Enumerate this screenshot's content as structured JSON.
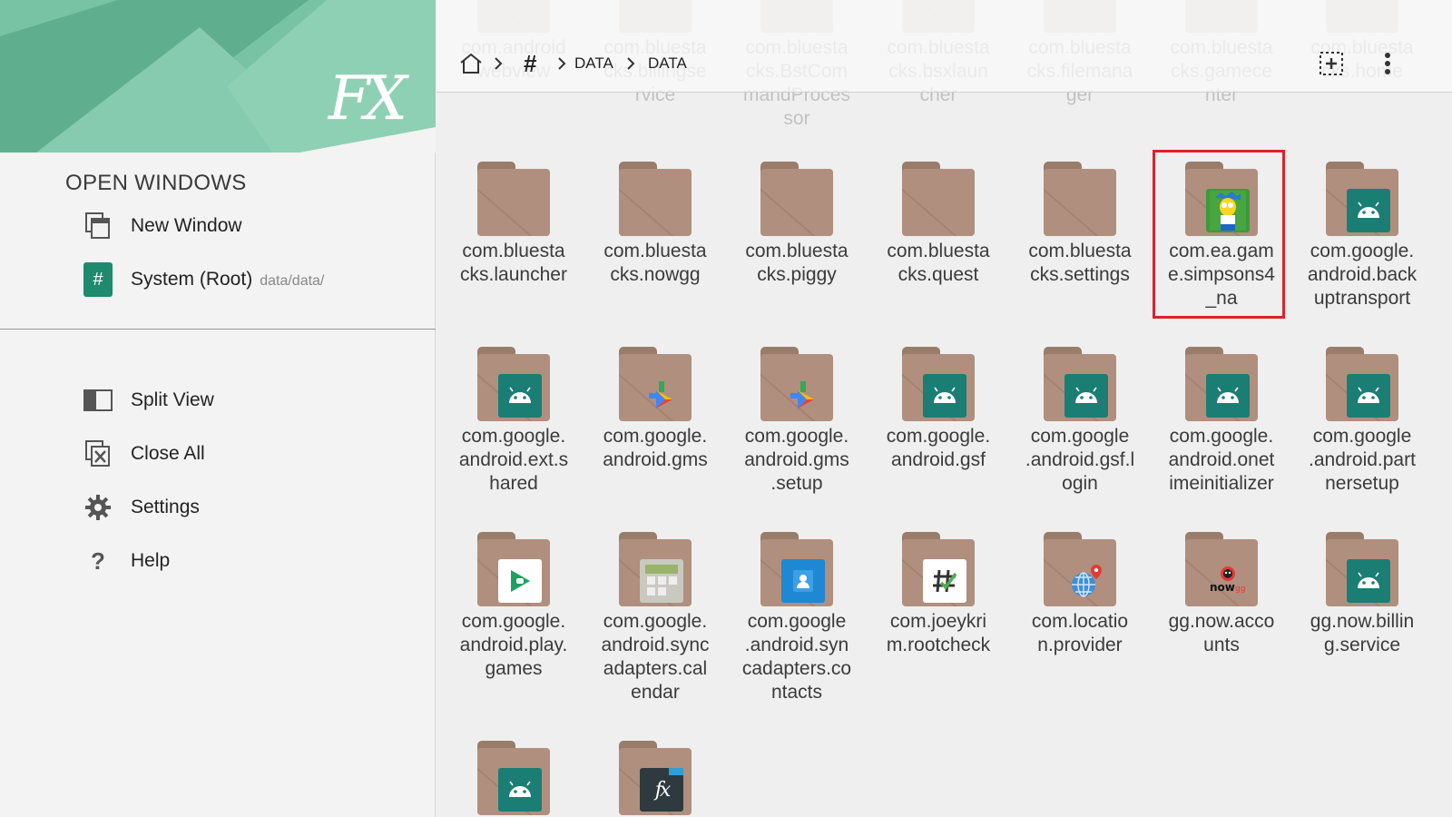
{
  "sidebar": {
    "logo_text": "FX",
    "section_title": "OPEN WINDOWS",
    "new_window": "New Window",
    "root_window": {
      "label": "System (Root)",
      "path": "data/data/",
      "badge": "#"
    },
    "split_view": "Split View",
    "close_all": "Close All",
    "settings": "Settings",
    "help": "Help"
  },
  "toolbar": {
    "crumb_root": "#",
    "crumb_1": "DATA",
    "crumb_2": "DATA"
  },
  "top_row_faded": [
    {
      "name": "com.android\nwebview"
    },
    {
      "name": "com.bluesta\ncks.billingse\nrvice"
    },
    {
      "name": "com.bluesta\ncks.BstCom\nmandProces\nsor"
    },
    {
      "name": "com.bluesta\ncks.bsxlaun\ncher"
    },
    {
      "name": "com.bluesta\ncks.filemana\nger"
    },
    {
      "name": "com.bluesta\ncks.gamece\nnter"
    },
    {
      "name": "com.bluesta\ncks.home"
    }
  ],
  "items": [
    {
      "name": "com.bluesta\ncks.launcher",
      "icon": "plain-folder-icon"
    },
    {
      "name": "com.bluesta\ncks.nowgg",
      "icon": "plain-folder-icon"
    },
    {
      "name": "com.bluesta\ncks.piggy",
      "icon": "plain-folder-icon"
    },
    {
      "name": "com.bluesta\ncks.quest",
      "icon": "plain-folder-icon"
    },
    {
      "name": "com.bluesta\ncks.settings",
      "icon": "plain-folder-icon"
    },
    {
      "name": "com.ea.gam\ne.simpsons4\n_na",
      "icon": "simpsons-app-icon"
    },
    {
      "name": "com.google.\nandroid.back\nuptransport",
      "icon": "android-icon"
    },
    {
      "name": "com.google.\nandroid.ext.s\nhared",
      "icon": "android-icon"
    },
    {
      "name": "com.google.\nandroid.gms",
      "icon": "play-services-icon"
    },
    {
      "name": "com.google.\nandroid.gms\n.setup",
      "icon": "play-services-icon"
    },
    {
      "name": "com.google.\nandroid.gsf",
      "icon": "android-icon"
    },
    {
      "name": "com.google\n.android.gsf.l\nogin",
      "icon": "android-icon"
    },
    {
      "name": "com.google.\nandroid.onet\nimeinitializer",
      "icon": "android-icon"
    },
    {
      "name": "com.google\n.android.part\nnersetup",
      "icon": "android-icon"
    },
    {
      "name": "com.google.\nandroid.play.\ngames",
      "icon": "play-games-icon"
    },
    {
      "name": "com.google.\nandroid.sync\nadapters.cal\nendar",
      "icon": "calendar-icon"
    },
    {
      "name": "com.google\n.android.syn\ncadapters.co\nntacts",
      "icon": "contacts-icon"
    },
    {
      "name": "com.joeykri\nm.rootcheck",
      "icon": "rootcheck-icon"
    },
    {
      "name": "com.locatio\nn.provider",
      "icon": "globe-location-icon"
    },
    {
      "name": "gg.now.acco\nunts",
      "icon": "nowgg-icon"
    },
    {
      "name": "gg.now.billin\ng.service",
      "icon": "android-icon"
    },
    {
      "name": "",
      "icon": "android-icon"
    },
    {
      "name": "",
      "icon": "fx-app-icon"
    }
  ],
  "colors": {
    "accent": "#1e8a6e",
    "folder": "#b08f7e",
    "highlight": "#e0202a"
  }
}
